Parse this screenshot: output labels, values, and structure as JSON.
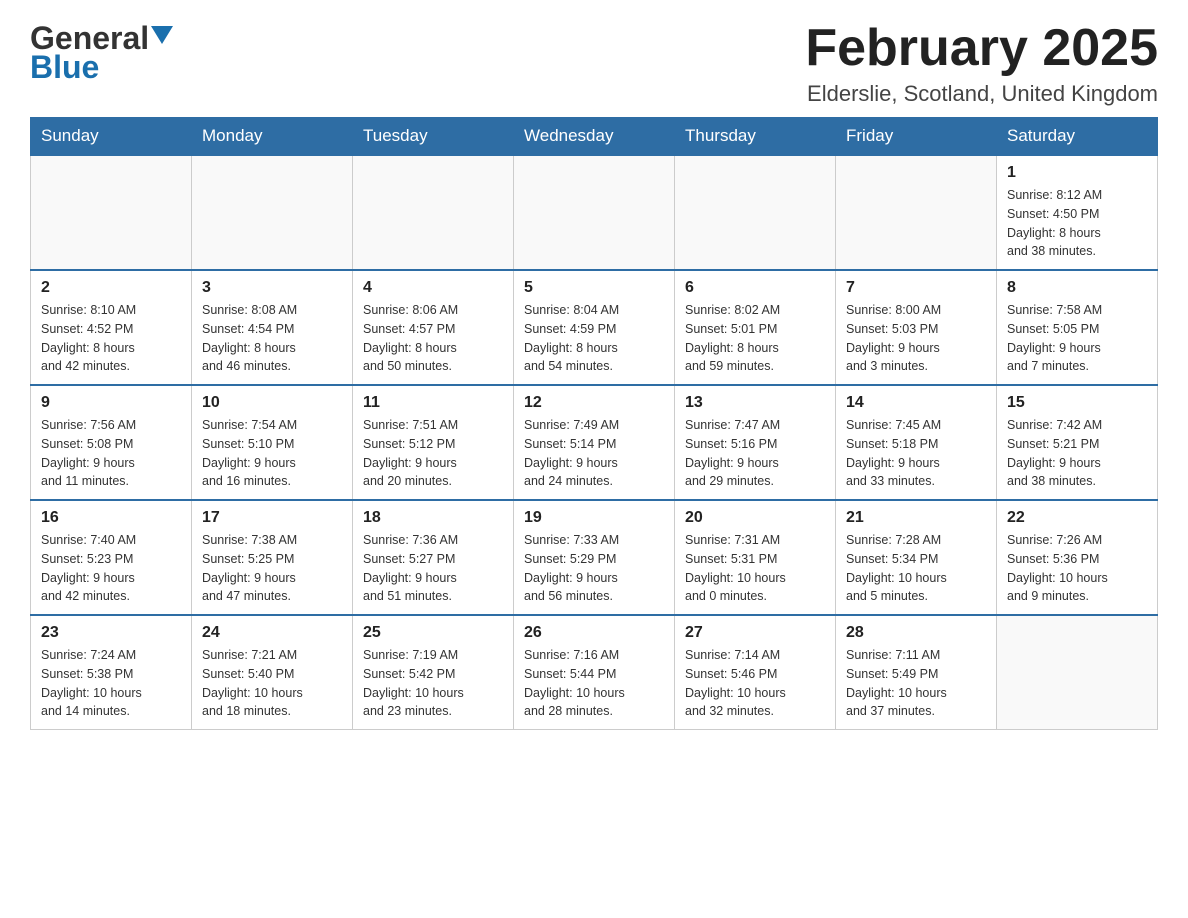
{
  "header": {
    "logo_general": "General",
    "logo_blue": "Blue",
    "title": "February 2025",
    "location": "Elderslie, Scotland, United Kingdom"
  },
  "days_of_week": [
    "Sunday",
    "Monday",
    "Tuesday",
    "Wednesday",
    "Thursday",
    "Friday",
    "Saturday"
  ],
  "weeks": [
    [
      {
        "day": "",
        "info": ""
      },
      {
        "day": "",
        "info": ""
      },
      {
        "day": "",
        "info": ""
      },
      {
        "day": "",
        "info": ""
      },
      {
        "day": "",
        "info": ""
      },
      {
        "day": "",
        "info": ""
      },
      {
        "day": "1",
        "info": "Sunrise: 8:12 AM\nSunset: 4:50 PM\nDaylight: 8 hours\nand 38 minutes."
      }
    ],
    [
      {
        "day": "2",
        "info": "Sunrise: 8:10 AM\nSunset: 4:52 PM\nDaylight: 8 hours\nand 42 minutes."
      },
      {
        "day": "3",
        "info": "Sunrise: 8:08 AM\nSunset: 4:54 PM\nDaylight: 8 hours\nand 46 minutes."
      },
      {
        "day": "4",
        "info": "Sunrise: 8:06 AM\nSunset: 4:57 PM\nDaylight: 8 hours\nand 50 minutes."
      },
      {
        "day": "5",
        "info": "Sunrise: 8:04 AM\nSunset: 4:59 PM\nDaylight: 8 hours\nand 54 minutes."
      },
      {
        "day": "6",
        "info": "Sunrise: 8:02 AM\nSunset: 5:01 PM\nDaylight: 8 hours\nand 59 minutes."
      },
      {
        "day": "7",
        "info": "Sunrise: 8:00 AM\nSunset: 5:03 PM\nDaylight: 9 hours\nand 3 minutes."
      },
      {
        "day": "8",
        "info": "Sunrise: 7:58 AM\nSunset: 5:05 PM\nDaylight: 9 hours\nand 7 minutes."
      }
    ],
    [
      {
        "day": "9",
        "info": "Sunrise: 7:56 AM\nSunset: 5:08 PM\nDaylight: 9 hours\nand 11 minutes."
      },
      {
        "day": "10",
        "info": "Sunrise: 7:54 AM\nSunset: 5:10 PM\nDaylight: 9 hours\nand 16 minutes."
      },
      {
        "day": "11",
        "info": "Sunrise: 7:51 AM\nSunset: 5:12 PM\nDaylight: 9 hours\nand 20 minutes."
      },
      {
        "day": "12",
        "info": "Sunrise: 7:49 AM\nSunset: 5:14 PM\nDaylight: 9 hours\nand 24 minutes."
      },
      {
        "day": "13",
        "info": "Sunrise: 7:47 AM\nSunset: 5:16 PM\nDaylight: 9 hours\nand 29 minutes."
      },
      {
        "day": "14",
        "info": "Sunrise: 7:45 AM\nSunset: 5:18 PM\nDaylight: 9 hours\nand 33 minutes."
      },
      {
        "day": "15",
        "info": "Sunrise: 7:42 AM\nSunset: 5:21 PM\nDaylight: 9 hours\nand 38 minutes."
      }
    ],
    [
      {
        "day": "16",
        "info": "Sunrise: 7:40 AM\nSunset: 5:23 PM\nDaylight: 9 hours\nand 42 minutes."
      },
      {
        "day": "17",
        "info": "Sunrise: 7:38 AM\nSunset: 5:25 PM\nDaylight: 9 hours\nand 47 minutes."
      },
      {
        "day": "18",
        "info": "Sunrise: 7:36 AM\nSunset: 5:27 PM\nDaylight: 9 hours\nand 51 minutes."
      },
      {
        "day": "19",
        "info": "Sunrise: 7:33 AM\nSunset: 5:29 PM\nDaylight: 9 hours\nand 56 minutes."
      },
      {
        "day": "20",
        "info": "Sunrise: 7:31 AM\nSunset: 5:31 PM\nDaylight: 10 hours\nand 0 minutes."
      },
      {
        "day": "21",
        "info": "Sunrise: 7:28 AM\nSunset: 5:34 PM\nDaylight: 10 hours\nand 5 minutes."
      },
      {
        "day": "22",
        "info": "Sunrise: 7:26 AM\nSunset: 5:36 PM\nDaylight: 10 hours\nand 9 minutes."
      }
    ],
    [
      {
        "day": "23",
        "info": "Sunrise: 7:24 AM\nSunset: 5:38 PM\nDaylight: 10 hours\nand 14 minutes."
      },
      {
        "day": "24",
        "info": "Sunrise: 7:21 AM\nSunset: 5:40 PM\nDaylight: 10 hours\nand 18 minutes."
      },
      {
        "day": "25",
        "info": "Sunrise: 7:19 AM\nSunset: 5:42 PM\nDaylight: 10 hours\nand 23 minutes."
      },
      {
        "day": "26",
        "info": "Sunrise: 7:16 AM\nSunset: 5:44 PM\nDaylight: 10 hours\nand 28 minutes."
      },
      {
        "day": "27",
        "info": "Sunrise: 7:14 AM\nSunset: 5:46 PM\nDaylight: 10 hours\nand 32 minutes."
      },
      {
        "day": "28",
        "info": "Sunrise: 7:11 AM\nSunset: 5:49 PM\nDaylight: 10 hours\nand 37 minutes."
      },
      {
        "day": "",
        "info": ""
      }
    ]
  ]
}
